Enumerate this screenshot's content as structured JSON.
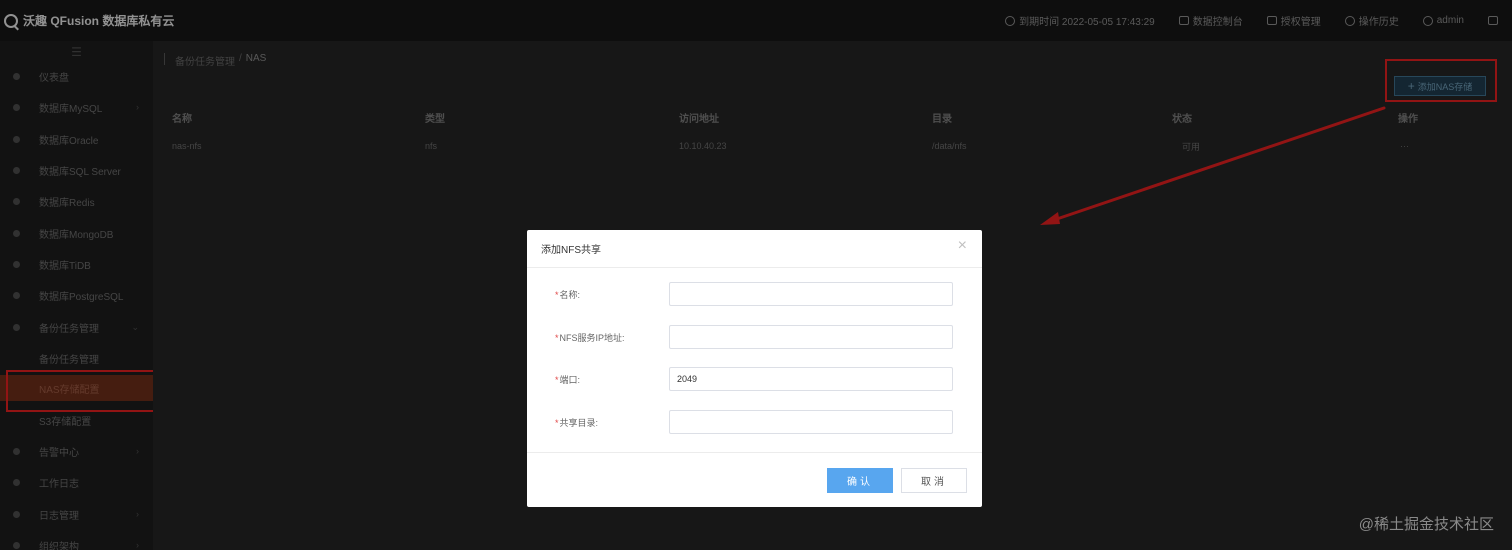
{
  "app": {
    "title": "沃趣 QFusion 数据库私有云"
  },
  "header": {
    "datetime": "到期时间 2022-05-05 17:43:29",
    "items": [
      "数据控制台",
      "授权管理",
      "操作历史"
    ],
    "user": "admin"
  },
  "sidebar": {
    "items": [
      {
        "label": "仪表盘"
      },
      {
        "label": "数据库MySQL"
      },
      {
        "label": "数据库Oracle"
      },
      {
        "label": "数据库SQL Server"
      },
      {
        "label": "数据库Redis"
      },
      {
        "label": "数据库MongoDB"
      },
      {
        "label": "数据库TiDB"
      },
      {
        "label": "数据库PostgreSQL"
      },
      {
        "label": "备份任务管理"
      },
      {
        "label": "备份任务管理"
      },
      {
        "label": "NAS存储配置"
      },
      {
        "label": "S3存储配置"
      },
      {
        "label": "告警中心"
      },
      {
        "label": "工作日志"
      },
      {
        "label": "日志管理"
      },
      {
        "label": "组织架构"
      }
    ]
  },
  "breadcrumb": {
    "parent": "备份任务管理",
    "sep": "/",
    "current": "NAS"
  },
  "toolbar": {
    "add_label": "添加NAS存储",
    "add_icon": "+"
  },
  "table": {
    "headers": [
      "名称",
      "类型",
      "访问地址",
      "目录",
      "状态",
      "操作"
    ],
    "rows": [
      {
        "name": "nas-nfs",
        "type": "nfs",
        "address": "10.10.40.23",
        "dir": "/data/nfs",
        "status": "可用",
        "ops": "···"
      }
    ]
  },
  "modal": {
    "title": "添加NFS共享",
    "close": "×",
    "fields": [
      {
        "label": "名称:",
        "value": "",
        "placeholder": ""
      },
      {
        "label": "NFS服务IP地址:",
        "value": "",
        "placeholder": ""
      },
      {
        "label": "端口:",
        "value": "2049",
        "placeholder": ""
      },
      {
        "label": "共享目录:",
        "value": "",
        "placeholder": ""
      }
    ],
    "required_mark": "*",
    "ok_label": "确认",
    "cancel_label": "取消"
  },
  "watermark": "@稀土掘金技术社区",
  "colors": {
    "annotation": "#e02020",
    "primary": "#58a6ef",
    "active_menu": "#6b2d1a"
  }
}
